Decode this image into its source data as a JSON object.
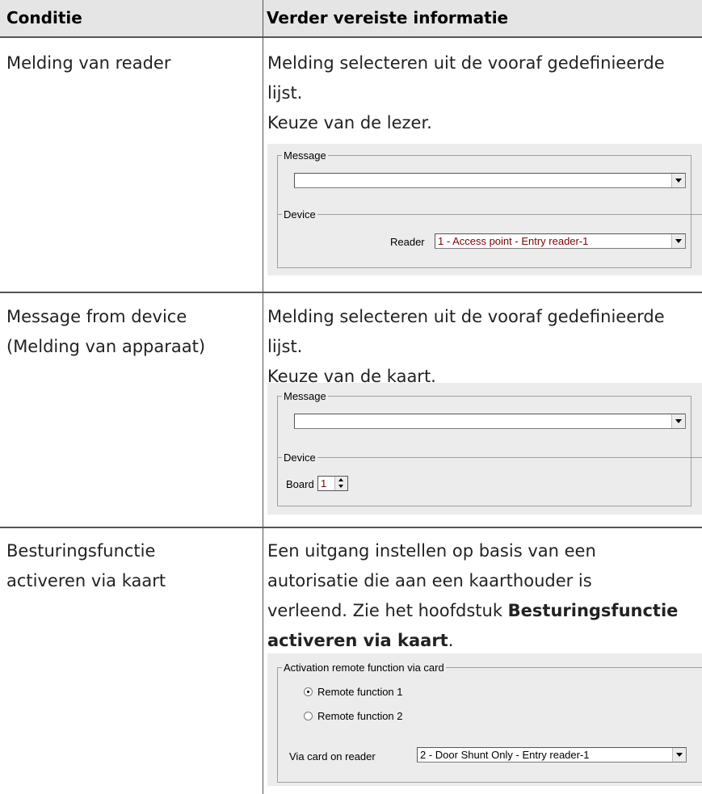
{
  "table": {
    "headers": {
      "condition": "Conditie",
      "info": "Verder vereiste informatie"
    },
    "rows": [
      {
        "condition_lines": [
          "Melding van reader"
        ],
        "info_lines": [
          "Melding selecteren uit de vooraf gedefinieerde",
          "lijst.",
          "Keuze van de lezer."
        ],
        "dialog": {
          "message_legend": "Message",
          "message_value": "",
          "device_legend": "Device",
          "reader_label": "Reader",
          "reader_value": "1 - Access point - Entry reader-1"
        }
      },
      {
        "condition_lines": [
          "Message from device",
          "(Melding van apparaat)"
        ],
        "info_lines": [
          "Melding selecteren uit de vooraf gedefinieerde",
          "lijst.",
          "Keuze van de kaart."
        ],
        "dialog": {
          "message_legend": "Message",
          "message_value": "",
          "device_legend": "Device",
          "board_label": "Board",
          "board_value": "1"
        }
      },
      {
        "condition_lines": [
          "Besturingsfunctie",
          "activeren via kaart"
        ],
        "info_lines": [
          "Een uitgang instellen op basis van een",
          "autorisatie die aan een kaarthouder is"
        ],
        "info_line3_prefix": "verleend. Zie het hoofdstuk ",
        "info_line3_bold": "Besturingsfunctie",
        "info_line4_bold": "activeren via kaart",
        "info_line4_suffix": ".",
        "dialog": {
          "group_legend": "Activation remote function via card",
          "radio1_label": "Remote function  1",
          "radio1_selected": true,
          "radio2_label": "Remote function  2",
          "radio2_selected": false,
          "reader_label": "Via card on reader",
          "reader_value": "2 - Door Shunt Only - Entry reader-1"
        }
      }
    ]
  }
}
